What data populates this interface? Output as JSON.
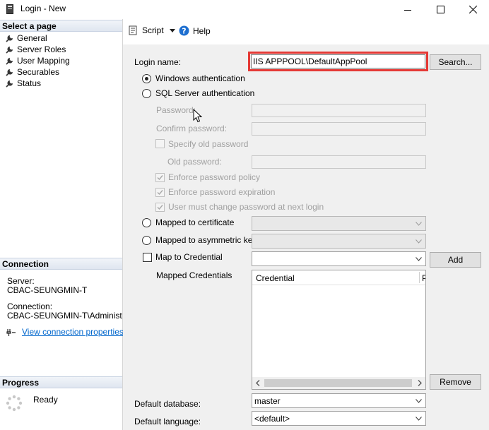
{
  "window": {
    "title": "Login - New"
  },
  "left_panel": {
    "select_page_header": "Select a page",
    "pages": [
      {
        "label": "General",
        "icon": "wrench-icon"
      },
      {
        "label": "Server Roles",
        "icon": "wrench-icon"
      },
      {
        "label": "User Mapping",
        "icon": "wrench-icon"
      },
      {
        "label": "Securables",
        "icon": "wrench-icon"
      },
      {
        "label": "Status",
        "icon": "wrench-icon"
      }
    ],
    "connection": {
      "header": "Connection",
      "server_label": "Server:",
      "server_value": "CBAC-SEUNGMIN-T",
      "connection_label": "Connection:",
      "connection_value": "CBAC-SEUNGMIN-T\\Administrator",
      "view_link": "View connection properties"
    },
    "progress": {
      "header": "Progress",
      "status": "Ready"
    }
  },
  "toolbar": {
    "script_label": "Script",
    "help_label": "Help"
  },
  "form": {
    "login_name_label": "Login name:",
    "login_name_value": "IIS APPPOOL\\DefaultAppPool",
    "search_button": "Search...",
    "windows_auth": "Windows authentication",
    "sql_auth": "SQL Server authentication",
    "password_label": "Password:",
    "confirm_password_label": "Confirm password:",
    "specify_old_password": "Specify old password",
    "old_password_label": "Old password:",
    "enforce_policy": "Enforce password policy",
    "enforce_expiration": "Enforce password expiration",
    "must_change": "User must change password at next login",
    "mapped_certificate": "Mapped to certificate",
    "mapped_asym_key": "Mapped to asymmetric key",
    "map_credential": "Map to Credential",
    "add_button": "Add",
    "mapped_credentials_label": "Mapped Credentials",
    "credential_columns": [
      "Credential",
      "P"
    ],
    "remove_button": "Remove",
    "default_database_label": "Default database:",
    "default_database_value": "master",
    "default_language_label": "Default language:",
    "default_language_value": "<default>"
  },
  "colors": {
    "highlight_border": "#e53935",
    "link": "#0066cc",
    "panel_bg": "#f0f0f0"
  }
}
